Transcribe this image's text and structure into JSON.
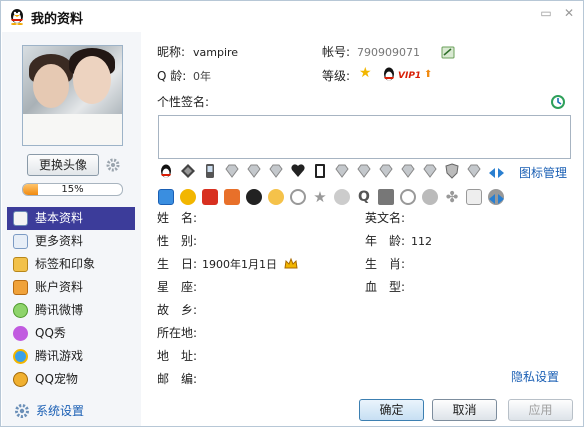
{
  "window": {
    "title": "我的资料",
    "minimize_symbol": "▭",
    "close_symbol": "✕"
  },
  "sidebar": {
    "change_avatar_label": "更换头像",
    "progress_text": "15%",
    "progress_value": 0.15,
    "items": [
      {
        "label": "基本资料",
        "icon": "id-card-icon",
        "active": true
      },
      {
        "label": "更多资料",
        "icon": "list-icon",
        "active": false
      },
      {
        "label": "标签和印象",
        "icon": "tag-icon",
        "active": false
      },
      {
        "label": "账户资料",
        "icon": "wallet-icon",
        "active": false
      },
      {
        "label": "腾讯微博",
        "icon": "weibo-icon",
        "active": false
      },
      {
        "label": "QQ秀",
        "icon": "heart-icon",
        "active": false
      },
      {
        "label": "腾讯游戏",
        "icon": "game-icon",
        "active": false
      },
      {
        "label": "QQ宠物",
        "icon": "pet-icon",
        "active": false
      }
    ],
    "system_settings_label": "系统设置"
  },
  "profile": {
    "nickname_label": "昵称:",
    "nickname_value": "vampire",
    "account_label": "帐号:",
    "account_value": "790909071",
    "qage_label": "Q 龄:",
    "qage_value": "0年",
    "level_label": "等级:",
    "vip_text": "VIP1",
    "signature_label": "个性签名:",
    "signature_value": "",
    "icon_manage_label": "图标管理",
    "fields_left": [
      {
        "label": "姓　名:",
        "value": ""
      },
      {
        "label": "性　别:",
        "value": ""
      },
      {
        "label": "生　日:",
        "value": "1900年1月1日"
      },
      {
        "label": "星　座:",
        "value": ""
      },
      {
        "label": "故　乡:",
        "value": ""
      },
      {
        "label": "所在地:",
        "value": ""
      },
      {
        "label": "地　址:",
        "value": ""
      },
      {
        "label": "邮　编:",
        "value": ""
      }
    ],
    "fields_right": [
      {
        "label": "英文名:",
        "value": ""
      },
      {
        "label": "年　龄:",
        "value": "112"
      },
      {
        "label": "生　肖:",
        "value": ""
      },
      {
        "label": "血　型:",
        "value": ""
      }
    ],
    "privacy_label": "隐私设置"
  },
  "buttons": {
    "ok": "确定",
    "cancel": "取消",
    "apply": "应用"
  },
  "colors": {
    "accent": "#3c3c9a",
    "link": "#1a5fb4",
    "progress": "#f08a10"
  }
}
